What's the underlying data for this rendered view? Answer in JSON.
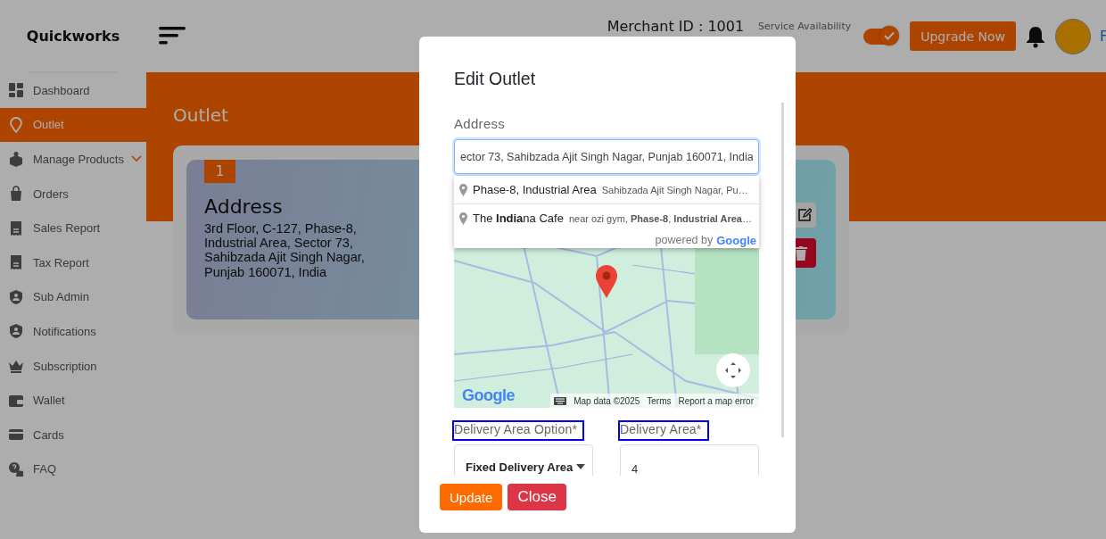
{
  "header": {
    "brand": "Quickworks",
    "merchant_id": "Merchant ID : 1001",
    "service_label": "Service Availability",
    "service_on": true,
    "upgrade_button": "Upgrade Now",
    "profile_name": "F"
  },
  "sidebar": {
    "items": [
      {
        "label": "Dashboard",
        "selected": false,
        "has_submenu": false
      },
      {
        "label": "Outlet",
        "selected": true,
        "has_submenu": false
      },
      {
        "label": "Manage Products",
        "selected": false,
        "has_submenu": true
      },
      {
        "label": "Orders",
        "selected": false,
        "has_submenu": false
      },
      {
        "label": "Sales Report",
        "selected": false,
        "has_submenu": false
      },
      {
        "label": "Tax Report",
        "selected": false,
        "has_submenu": false
      },
      {
        "label": "Sub Admin",
        "selected": false,
        "has_submenu": false
      },
      {
        "label": "Notifications",
        "selected": false,
        "has_submenu": false
      },
      {
        "label": "Subscription",
        "selected": false,
        "has_submenu": false
      },
      {
        "label": "Wallet",
        "selected": false,
        "has_submenu": false
      },
      {
        "label": "Cards",
        "selected": false,
        "has_submenu": false
      },
      {
        "label": "FAQ",
        "selected": false,
        "has_submenu": false
      }
    ]
  },
  "page": {
    "title": "Outlet",
    "outlets": [
      {
        "number": "1",
        "heading": "Address",
        "address": "3rd Floor, C-127, Phase-8, Industrial Area, Sector 73, Sahibzada Ajit Singh Nagar, Punjab 160071, India"
      }
    ]
  },
  "modal": {
    "title": "Edit Outlet",
    "address_label": "Address",
    "address_value": "ector 73, Sahibzada Ajit Singh Nagar, Punjab 160071, India",
    "suggestions": [
      {
        "title": "Phase-8, Industrial Area",
        "detail": "Sahibzada Ajit Singh Nagar, Pu…"
      },
      {
        "title": "The **India**na Cafe",
        "detail": "near ozi gym, **Phase-8**, **Industrial Area**…"
      }
    ],
    "powered_by": "powered by",
    "powered_logo": "Google",
    "map": {
      "logo": "Google",
      "attribution": [
        "Map data ©2025",
        "Terms",
        "Report a map error"
      ]
    },
    "fields": [
      {
        "label": "Delivery Area Option*",
        "highlighted": true,
        "kind": "select",
        "value": "Fixed Delivery Area"
      },
      {
        "label": "Delivery Area*",
        "highlighted": true,
        "kind": "input",
        "value": "4"
      }
    ],
    "buttons": [
      {
        "label": "Update",
        "kind": "primary"
      },
      {
        "label": "Close",
        "kind": "danger"
      }
    ]
  }
}
